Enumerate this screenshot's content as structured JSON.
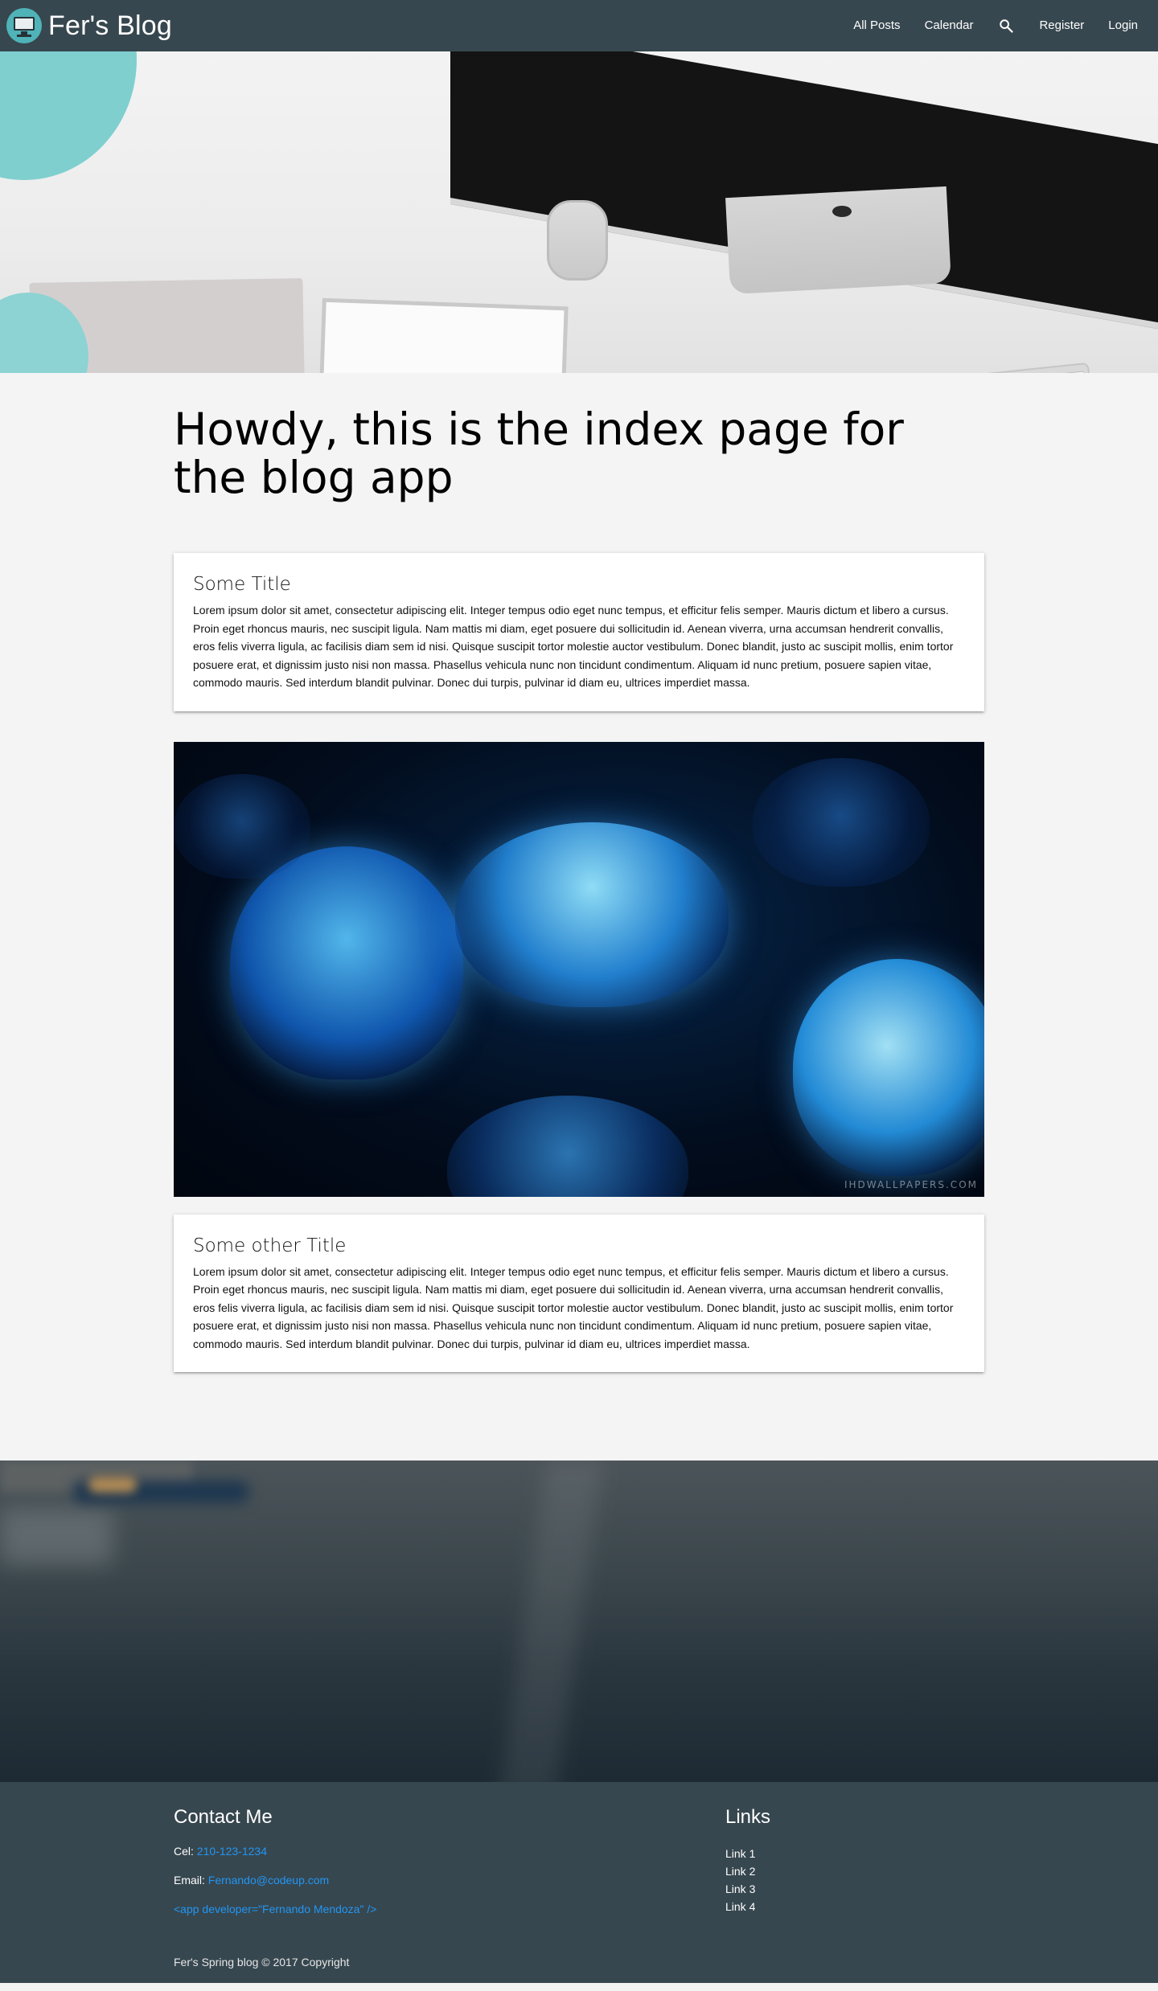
{
  "navbar": {
    "brand": "Fer's Blog",
    "links": {
      "all_posts": "All Posts",
      "calendar": "Calendar",
      "register": "Register",
      "login": "Login"
    }
  },
  "main": {
    "heading": "Howdy, this is the index page for the blog app",
    "posts": [
      {
        "title": "Some Title",
        "body": "Lorem ipsum dolor sit amet, consectetur adipiscing elit. Integer tempus odio eget nunc tempus, et efficitur felis semper. Mauris dictum et libero a cursus. Proin eget rhoncus mauris, nec suscipit ligula. Nam mattis mi diam, eget posuere dui sollicitudin id. Aenean viverra, urna accumsan hendrerit convallis, eros felis viverra ligula, ac facilisis diam sem id nisi. Quisque suscipit tortor molestie auctor vestibulum. Donec blandit, justo ac suscipit mollis, enim tortor posuere erat, et dignissim justo nisi non massa. Phasellus vehicula nunc non tincidunt condimentum. Aliquam id nunc pretium, posuere sapien vitae, commodo mauris. Sed interdum blandit pulvinar. Donec dui turpis, pulvinar id diam eu, ultrices imperdiet massa."
      },
      {
        "title": "Some other Title",
        "body": "Lorem ipsum dolor sit amet, consectetur adipiscing elit. Integer tempus odio eget nunc tempus, et efficitur felis semper. Mauris dictum et libero a cursus. Proin eget rhoncus mauris, nec suscipit ligula. Nam mattis mi diam, eget posuere dui sollicitudin id. Aenean viverra, urna accumsan hendrerit convallis, eros felis viverra ligula, ac facilisis diam sem id nisi. Quisque suscipit tortor molestie auctor vestibulum. Donec blandit, justo ac suscipit mollis, enim tortor posuere erat, et dignissim justo nisi non massa. Phasellus vehicula nunc non tincidunt condimentum. Aliquam id nunc pretium, posuere sapien vitae, commodo mauris. Sed interdum blandit pulvinar. Donec dui turpis, pulvinar id diam eu, ultrices imperdiet massa."
      }
    ],
    "image_watermark": "IHDWALLPAPERS.COM"
  },
  "footer": {
    "contact_heading": "Contact Me",
    "cel_label": "Cel:",
    "cel_value": "210-123-1234",
    "email_label": "Email:",
    "email_value": "Fernando@codeup.com",
    "developer_tag": "<app developer=\"Fernando Mendoza\" />",
    "links_heading": "Links",
    "links": [
      "Link 1",
      "Link 2",
      "Link 3",
      "Link 4"
    ],
    "copyright": "Fer's Spring blog © 2017 Copyright"
  },
  "icons": {
    "brand_logo": "computer-monitor-icon",
    "search": "search-icon"
  },
  "colors": {
    "navbar_bg": "#37474f",
    "page_bg": "#f4f4f4",
    "link_blue": "#2196f3"
  }
}
